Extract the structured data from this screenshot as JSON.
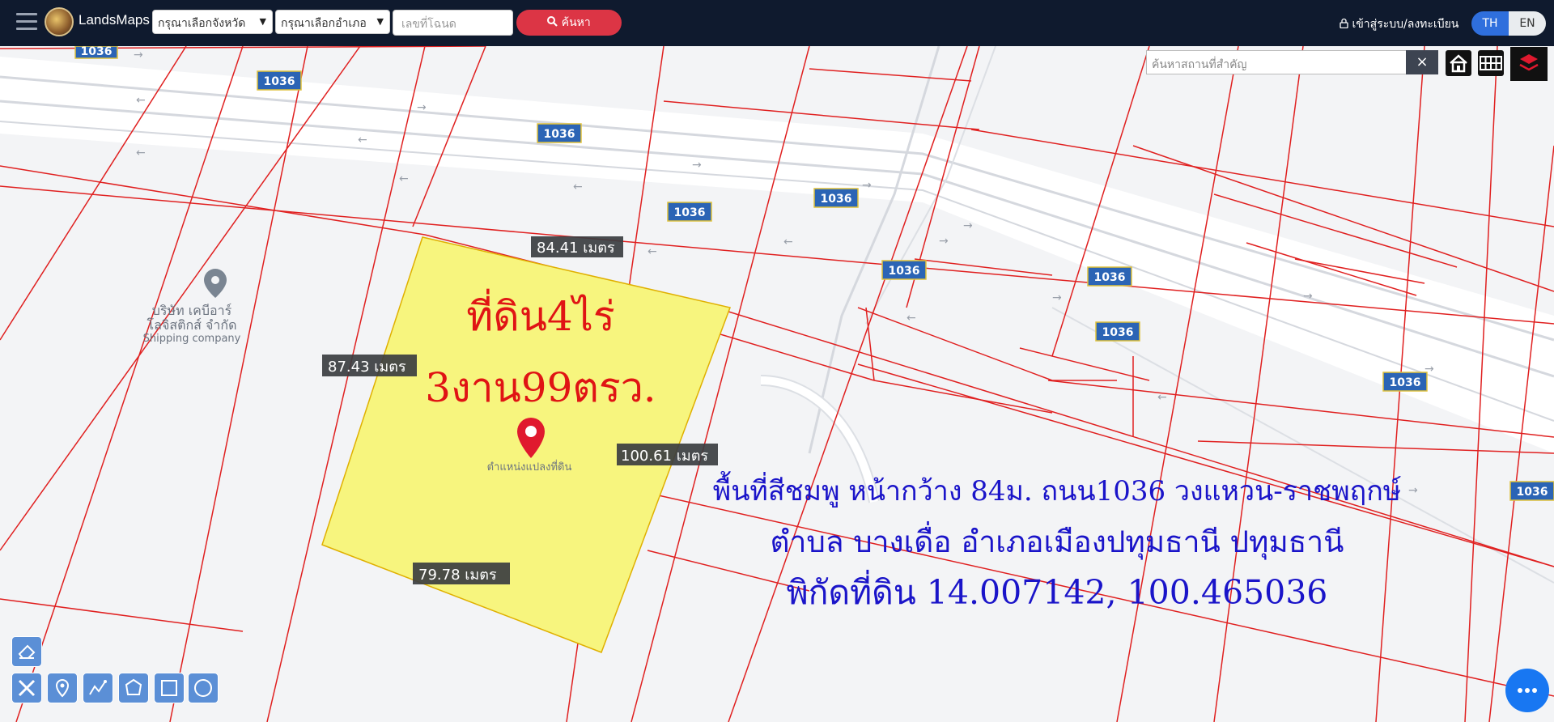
{
  "header": {
    "brand": "LandsMaps",
    "province_select": "กรุณาเลือกจังหวัด",
    "district_select": "กรุณาเลือกอำเภอ",
    "deed_placeholder": "เลขที่โฉนด",
    "search_label": "ค้นหา",
    "login_label": "เข้าสู่ระบบ/ลงทะเบียน",
    "lang_th": "TH",
    "lang_en": "EN"
  },
  "map_controls": {
    "place_search_placeholder": "ค้นหาสถานที่สำคัญ",
    "clear_label": "×"
  },
  "poi": {
    "name_line1": "บริษัท เคบีอาร์",
    "name_line2": "โลจิสติกส์ จำกัด",
    "category": "Shipping company"
  },
  "road_labels": [
    "1036",
    "1036",
    "1036",
    "1036",
    "1036",
    "1036",
    "1036",
    "1036",
    "1036",
    "1036"
  ],
  "plot": {
    "title_line1": "ที่ดิน4ไร่",
    "title_line2": "3งาน99ตรว.",
    "marker_label": "ตำแหน่งแปลงที่ดิน",
    "dimensions": {
      "top": "84.41 เมตร",
      "left": "87.43 เมตร",
      "right": "100.61 เมตร",
      "bottom": "79.78 เมตร"
    }
  },
  "annotation": {
    "line1": "พื้นที่สีชมพู หน้ากว้าง 84ม. ถนน1036 วงแหวน-ราชพฤกษ์",
    "line2": "ตำบล บางเดื่อ อำเภอเมืองปทุมธานี ปทุมธานี",
    "line3": "พิกัดที่ดิน 14.007142, 100.465036"
  },
  "colors": {
    "topbar": "#0f1a2e",
    "plot_fill": "#f7f57e",
    "parcel_line": "#e02020",
    "annotation_text": "#1a14c9",
    "title_text": "#e01414",
    "search_button": "#dc3545"
  }
}
